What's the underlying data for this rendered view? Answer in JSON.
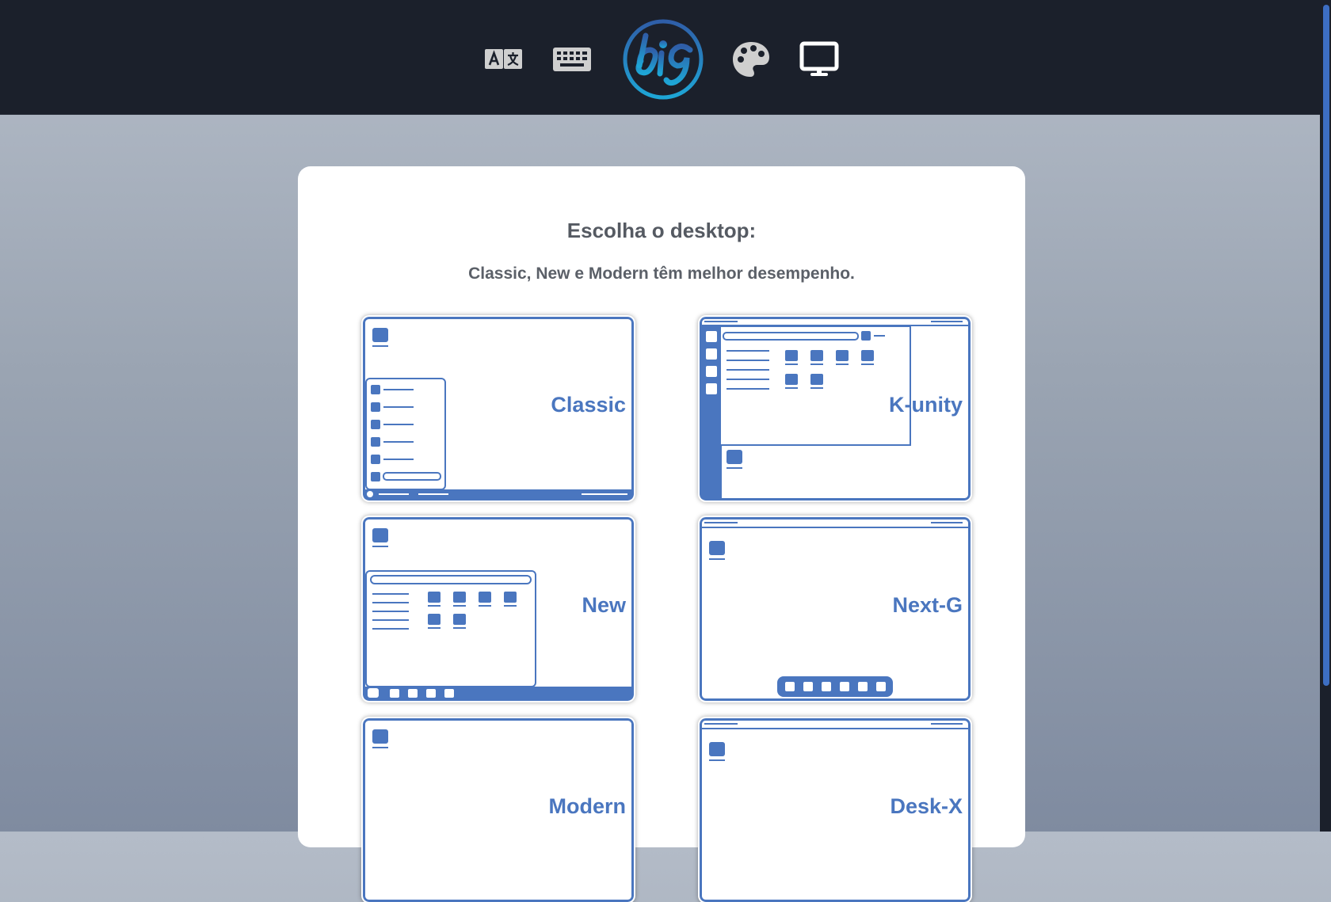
{
  "colors": {
    "accent": "#4a76bf",
    "topbar": "#1b202b",
    "icon": "#d6d6d6"
  },
  "topbar": {
    "icons": [
      "language-icon",
      "keyboard-icon",
      "biglinux-logo",
      "palette-icon",
      "monitor-icon"
    ],
    "active": "monitor-icon"
  },
  "content": {
    "title": "Escolha o desktop:",
    "subtitle": "Classic, New e Modern têm melhor desempenho.",
    "options": [
      {
        "label": "Classic"
      },
      {
        "label": "K-unity"
      },
      {
        "label": "New"
      },
      {
        "label": "Next-G"
      },
      {
        "label": "Modern"
      },
      {
        "label": "Desk-X"
      }
    ]
  }
}
